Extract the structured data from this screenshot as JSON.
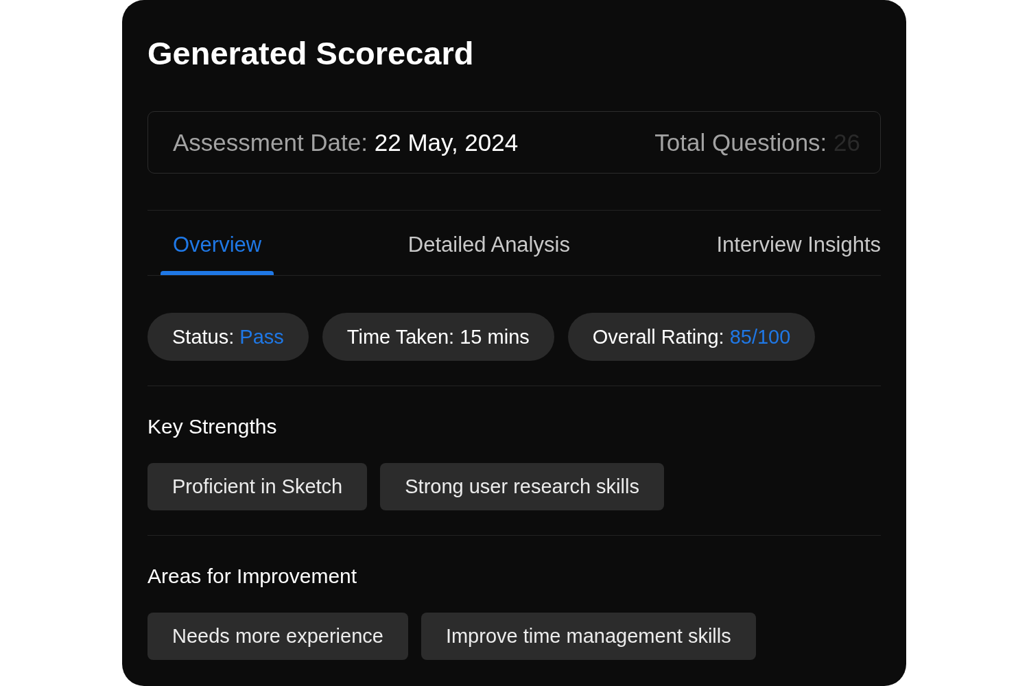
{
  "title": "Generated Scorecard",
  "summary": [
    {
      "label": "Assessment Date:",
      "value": "22 May, 2024",
      "faded": false
    },
    {
      "label": "Total Questions:",
      "value": "26",
      "faded": true
    }
  ],
  "tabs": [
    {
      "label": "Overview",
      "selected": true
    },
    {
      "label": "Detailed Analysis",
      "selected": false
    },
    {
      "label": "Interview Insights",
      "selected": false
    }
  ],
  "stats": [
    {
      "label": "Status:",
      "value": "Pass",
      "highlight": true
    },
    {
      "label": "Time Taken:",
      "value": "15 mins",
      "highlight": false
    },
    {
      "label": "Overall Rating:",
      "value": "85/100",
      "highlight": true
    }
  ],
  "sections": [
    {
      "heading": "Key Strengths",
      "items": [
        "Proficient in Sketch",
        "Strong user research skills"
      ]
    },
    {
      "heading": "Areas for Improvement",
      "items": [
        "Needs more experience",
        "Improve time management skills"
      ]
    }
  ]
}
